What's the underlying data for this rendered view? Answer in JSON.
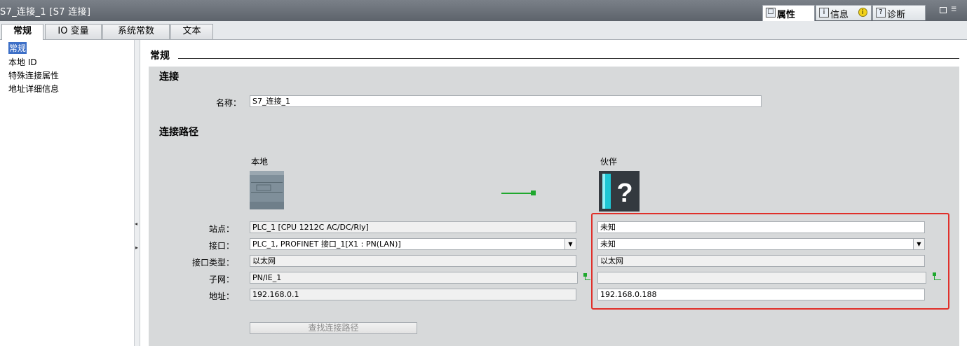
{
  "window": {
    "title": "S7_连接_1 [S7 连接]",
    "panel_tabs": [
      {
        "label": "属性",
        "icon": "properties-icon"
      },
      {
        "label": "信息",
        "icon": "info-icon"
      },
      {
        "label": "诊断",
        "icon": "diagnostics-icon"
      }
    ]
  },
  "tabs": [
    "常规",
    "IO 变量",
    "系统常数",
    "文本"
  ],
  "nav": [
    "常规",
    "本地 ID",
    "特殊连接属性",
    "地址详细信息"
  ],
  "page": {
    "heading": "常规",
    "section_connection": "连接",
    "name_label": "名称：",
    "name_value": "S7_连接_1",
    "section_path": "连接路径",
    "local_title": "本地",
    "partner_title": "伙伴",
    "row_labels": [
      "站点：",
      "接口：",
      "接口类型：",
      "子网：",
      "地址："
    ],
    "local": {
      "station": "PLC_1 [CPU 1212C AC/DC/Rly]",
      "interface": "PLC_1, PROFINET 接口_1[X1 : PN(LAN)]",
      "interface_type": "以太网",
      "subnet": "PN/IE_1",
      "address": "192.168.0.1"
    },
    "partner": {
      "station": "未知",
      "interface": "未知",
      "interface_type": "以太网",
      "subnet": "",
      "address": "192.168.0.188"
    },
    "find_path_button": "查找连接路径"
  },
  "colors": {
    "highlight": "#e0302a",
    "connection_line": "#1fa82e"
  }
}
